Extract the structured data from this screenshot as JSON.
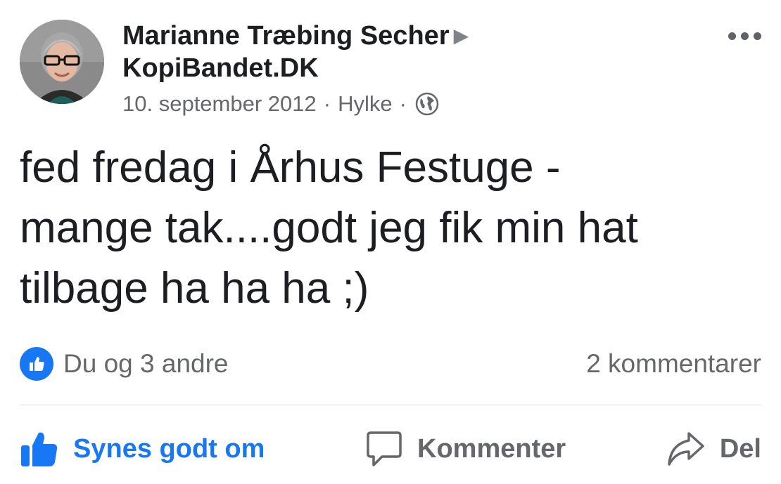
{
  "post": {
    "author": "Marianne Træbing Secher",
    "target_page": "KopiBandet.DK",
    "date": "10. september 2012",
    "location": "Hylke",
    "separator": "·",
    "privacy_icon": "globe-icon",
    "more_icon": "more-options-icon",
    "text_lines": [
      "fed fredag i Århus Festuge -",
      "mange tak....godt jeg fik min hat",
      "tilbage ha ha ha ;)"
    ]
  },
  "reactions": {
    "summary": "Du og 3 andre",
    "comments": "2 kommentarer"
  },
  "actions": {
    "like_label": "Synes godt om",
    "comment_label": "Kommenter",
    "share_label": "Del"
  },
  "colors": {
    "accent": "#1877f2",
    "text": "#1c1e21",
    "secondary": "#65676b"
  }
}
